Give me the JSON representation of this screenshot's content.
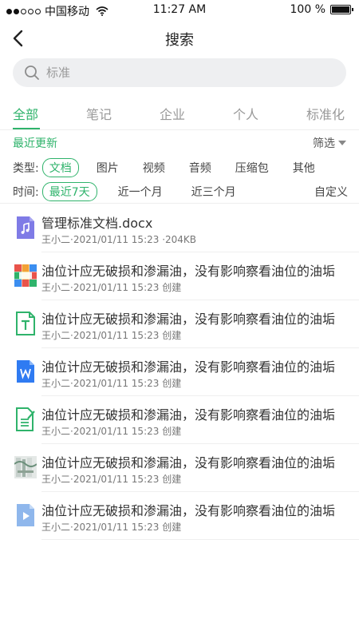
{
  "status_bar": {
    "carrier": "中国移动",
    "time": "11:27 AM",
    "battery": "100 %",
    "battery_level": 1.0
  },
  "nav": {
    "title": "搜索"
  },
  "search": {
    "placeholder": "标准"
  },
  "tabs": [
    {
      "label": "全部",
      "active": true
    },
    {
      "label": "笔记"
    },
    {
      "label": "企业"
    },
    {
      "label": "个人"
    },
    {
      "label": "标准化"
    }
  ],
  "section": {
    "recent": "最近更新",
    "filter": "筛选"
  },
  "type_filter": {
    "label": "类型:",
    "options": [
      "文档",
      "图片",
      "视频",
      "音频",
      "压缩包",
      "其他"
    ],
    "selected": "文档"
  },
  "time_filter": {
    "label": "时间:",
    "options": [
      "最近7天",
      "近一个月",
      "近三个月"
    ],
    "selected": "最近7天",
    "custom": "自定义"
  },
  "items": [
    {
      "icon": "audio-file-icon",
      "title": "管理标准文档.docx",
      "meta": "王小二·2021/01/11 15:23 ·204KB"
    },
    {
      "icon": "slides-file-icon",
      "title": "油位计应无破损和渗漏油，没有影响察看油位的油垢",
      "meta": "王小二·2021/01/11 15:23 创建"
    },
    {
      "icon": "text-file-icon",
      "title": "油位计应无破损和渗漏油，没有影响察看油位的油垢",
      "meta": "王小二·2021/01/11 15:23 创建"
    },
    {
      "icon": "word-file-icon",
      "title": "油位计应无破损和渗漏油，没有影响察看油位的油垢",
      "meta": "王小二·2021/01/11 15:23 创建"
    },
    {
      "icon": "note-file-icon",
      "title": "油位计应无破损和渗漏油，没有影响察看油位的油垢",
      "meta": "王小二·2021/01/11 15:23 创建"
    },
    {
      "icon": "image-thumbnail-icon",
      "title": "油位计应无破损和渗漏油，没有影响察看油位的油垢",
      "meta": "王小二·2021/01/11 15:23 创建"
    },
    {
      "icon": "video-file-icon",
      "title": "油位计应无破损和渗漏油，没有影响察看油位的油垢",
      "meta": "王小二·2021/01/11 15:23 创建"
    }
  ],
  "colors": {
    "accent": "#2fb36b"
  }
}
